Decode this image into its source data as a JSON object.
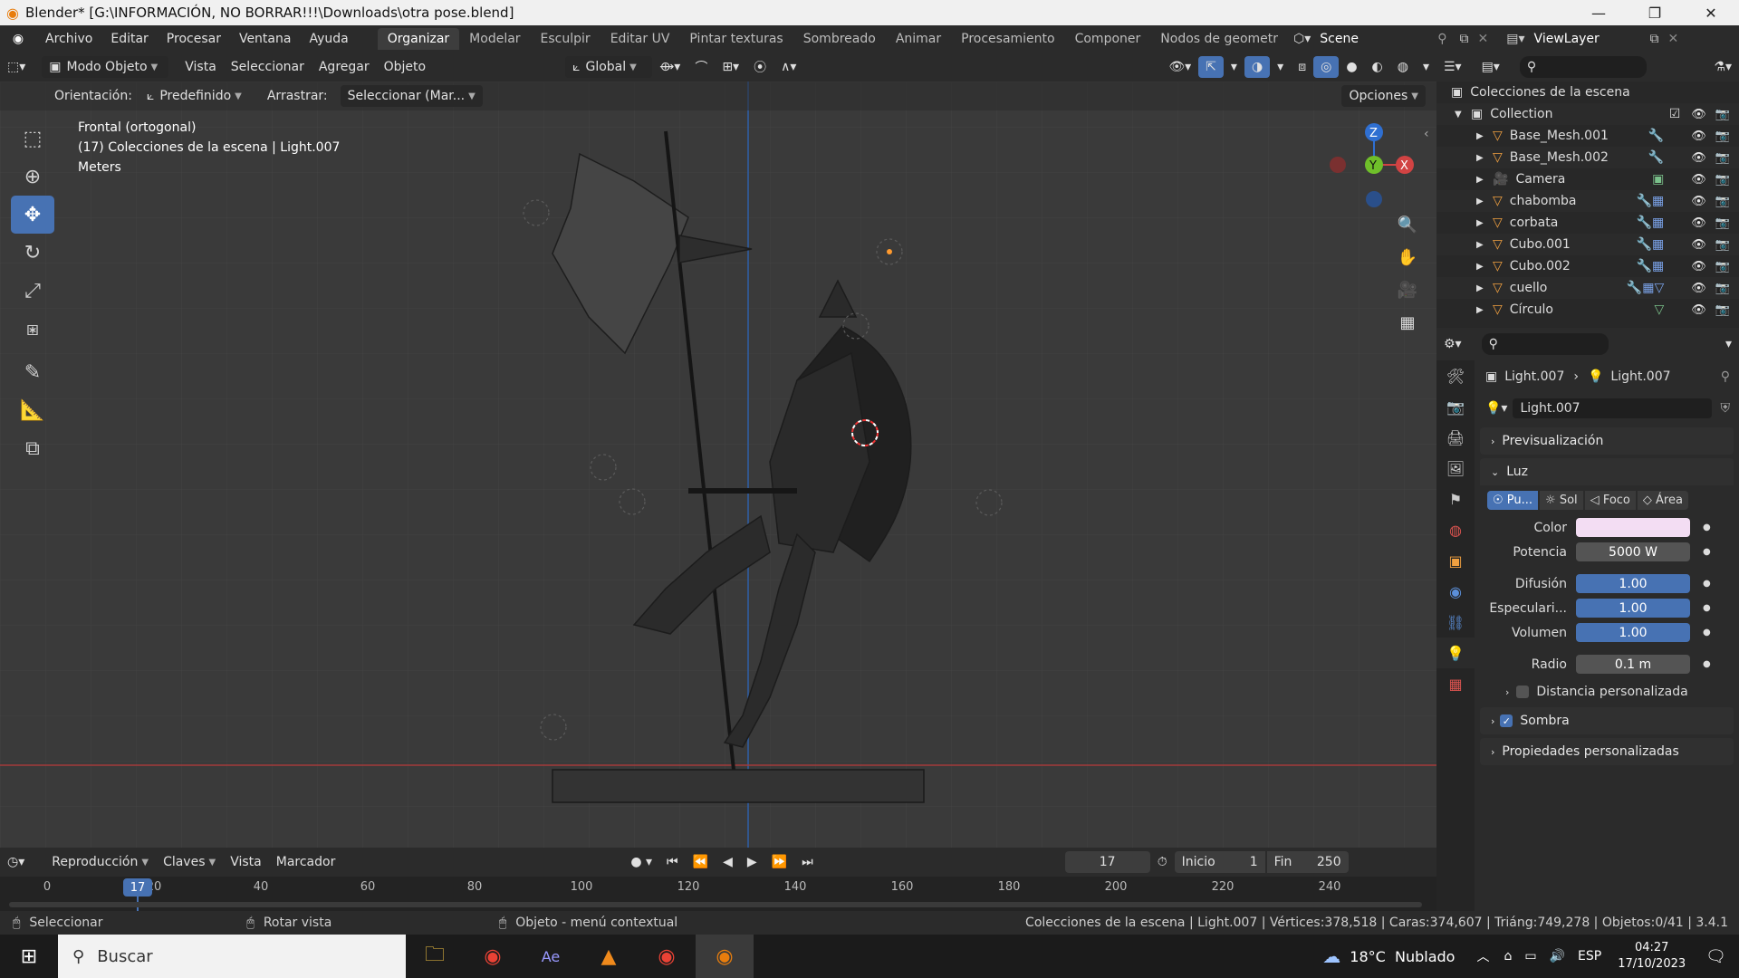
{
  "window": {
    "title": "Blender* [G:\\INFORMACIÓN, NO BORRAR!!!\\Downloads\\otra pose.blend]",
    "min": "—",
    "max": "❐",
    "close": "✕"
  },
  "menu": [
    "Archivo",
    "Editar",
    "Procesar",
    "Ventana",
    "Ayuda"
  ],
  "workspaces": [
    "Organizar",
    "Modelar",
    "Esculpir",
    "Editar UV",
    "Pintar texturas",
    "Sombreado",
    "Animar",
    "Procesamiento",
    "Componer",
    "Nodos de geometr"
  ],
  "scene_name": "Scene",
  "view_layer": "ViewLayer",
  "viewport_header": {
    "mode": "Modo Objeto",
    "menus": [
      "Vista",
      "Seleccionar",
      "Agregar",
      "Objeto"
    ],
    "transform_orientation": "Global"
  },
  "viewport_sub": {
    "orientation_label": "Orientación:",
    "orientation_value": "Predefinido",
    "drag_label": "Arrastrar:",
    "drag_value": "Seleccionar (Mar...",
    "options": "Opciones"
  },
  "viewport_info": {
    "line1": "Frontal (ortogonal)",
    "line2": "(17) Colecciones de la escena | Light.007",
    "line3": "Meters"
  },
  "gizmo": {
    "z": "Z",
    "y": "Y",
    "x": "X"
  },
  "outliner": {
    "root": "Colecciones de la escena",
    "collection": "Collection",
    "items": [
      "Base_Mesh.001",
      "Base_Mesh.002",
      "Camera",
      "chabomba",
      "corbata",
      "Cubo.001",
      "Cubo.002",
      "cuello",
      "Círculo"
    ]
  },
  "properties": {
    "breadcrumb_a": "Light.007",
    "breadcrumb_b": "Light.007",
    "datablock": "Light.007",
    "preview_panel": "Previsualización",
    "light_panel": "Luz",
    "light_types": [
      "Pu...",
      "Sol",
      "Foco",
      "Área"
    ],
    "color_label": "Color",
    "color_value": "#f3ddf3",
    "power_label": "Potencia",
    "power_value": "5000 W",
    "diffuse_label": "Difusión",
    "diffuse_value": "1.00",
    "specular_label": "Especulari...",
    "specular_value": "1.00",
    "volume_label": "Volumen",
    "volume_value": "1.00",
    "radius_label": "Radio",
    "radius_value": "0.1 m",
    "custom_distance": "Distancia personalizada",
    "shadow": "Sombra",
    "custom_props": "Propiedades personalizadas"
  },
  "timeline": {
    "playback": "Reproducción",
    "keys": "Claves",
    "view": "Vista",
    "marker": "Marcador",
    "current_frame": "17",
    "start_label": "Inicio",
    "start": "1",
    "end_label": "Fin",
    "end": "250",
    "ticks": [
      "0",
      "20",
      "40",
      "60",
      "80",
      "100",
      "120",
      "140",
      "160",
      "180",
      "200",
      "220",
      "240"
    ],
    "playhead_label": "17"
  },
  "status": {
    "select": "Seleccionar",
    "rotate": "Rotar vista",
    "context": "Objeto - menú contextual",
    "stats": "Colecciones de la escena | Light.007 | Vértices:378,518 | Caras:374,607 | Triáng:749,278 | Objetos:0/41 | 3.4.1"
  },
  "taskbar": {
    "search": "Buscar",
    "weather": "18°C  Nublado",
    "lang": "ESP",
    "time": "04:27",
    "date": "17/10/2023"
  }
}
